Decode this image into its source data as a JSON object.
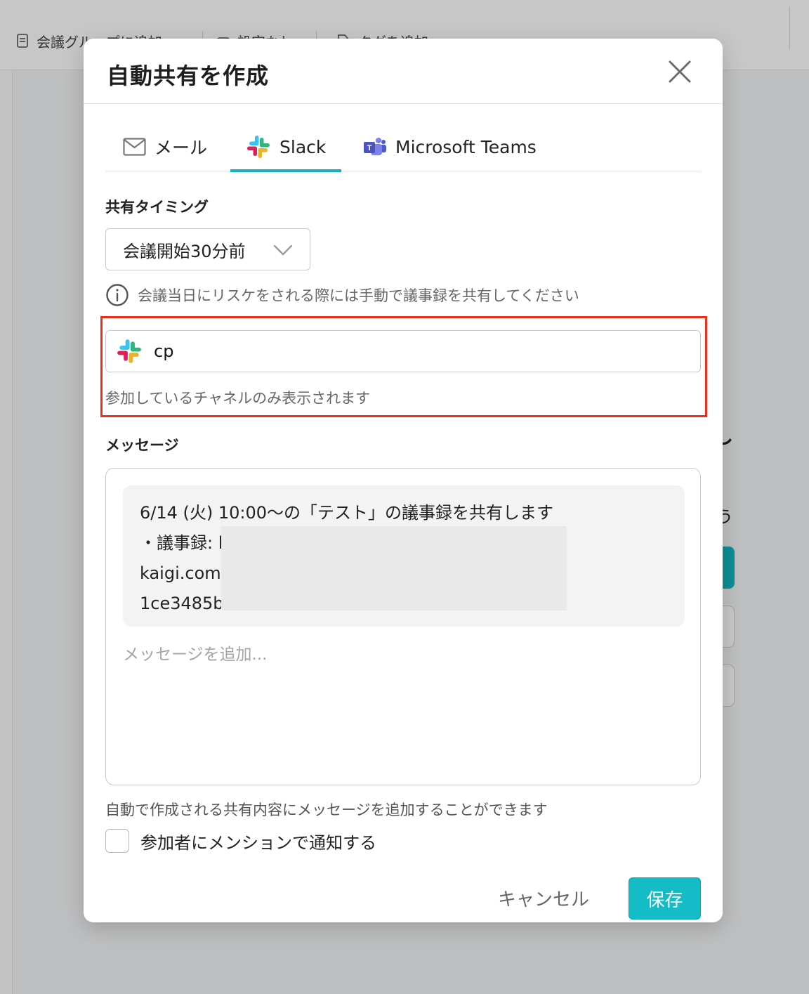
{
  "background": {
    "toolbar": {
      "items": [
        {
          "label": "会議グループに追加",
          "icon": "document-icon"
        },
        {
          "label": "設定なし",
          "icon": "toggle-icon"
        },
        {
          "label": "タグを追加",
          "icon": "tag-icon"
        }
      ]
    },
    "right_fragments": [
      "し",
      "う"
    ]
  },
  "modal": {
    "title": "自動共有を作成",
    "close_icon": "close-icon",
    "tabs": [
      {
        "label": "メール",
        "icon": "mail-icon",
        "active": false
      },
      {
        "label": "Slack",
        "icon": "slack-icon",
        "active": true
      },
      {
        "label": "Microsoft Teams",
        "icon": "teams-icon",
        "active": false
      }
    ],
    "timing": {
      "label": "共有タイミング",
      "selected": "会議開始30分前",
      "note": "会議当日にリスケをされる際には手動で議事録を共有してください"
    },
    "channel": {
      "value": "cp",
      "hint": "参加しているチャネルのみ表示されます"
    },
    "message": {
      "label": "メッセージ",
      "preview_lines": [
        "6/14 (火) 10:00〜の「テスト」の議事録を共有します",
        "・議事録: l",
        "kaigi.com",
        "1ce3485b"
      ],
      "placeholder": "メッセージを追加...",
      "hint": "自動で作成される共有内容にメッセージを追加することができます"
    },
    "mention_checkbox": {
      "label": "参加者にメンションで通知する",
      "checked": false
    },
    "buttons": {
      "cancel": "キャンセル",
      "save": "保存"
    }
  },
  "colors": {
    "accent": "#17aebc",
    "save_button": "#14bcc6",
    "highlight": "#e8301c"
  }
}
